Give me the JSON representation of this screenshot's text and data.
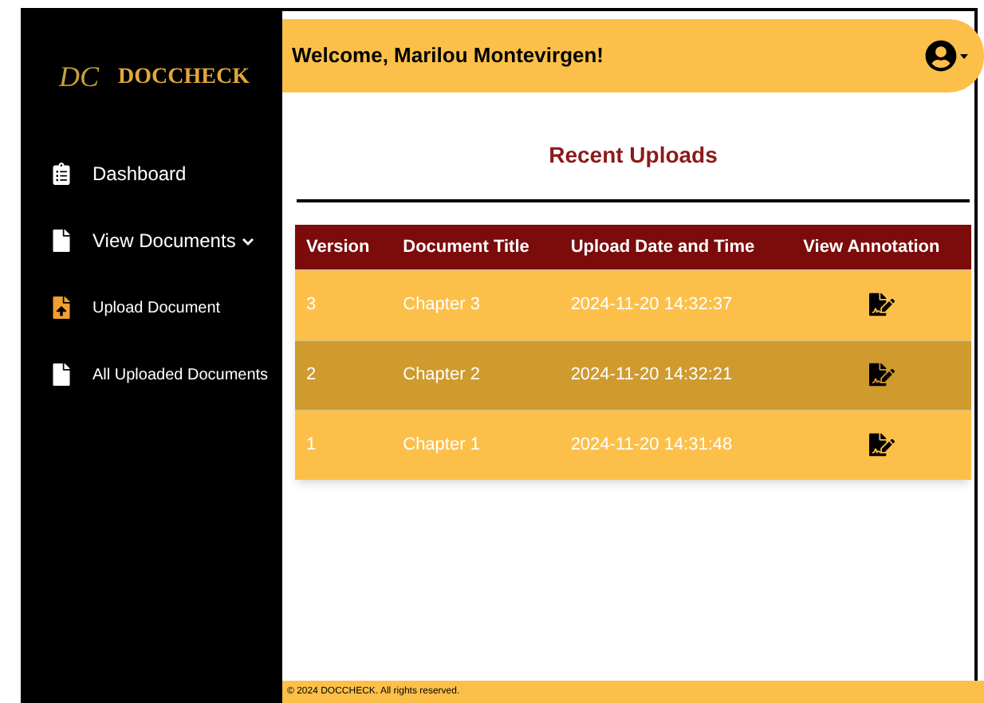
{
  "brand": {
    "logo": "DC",
    "name": "DOCCHECK"
  },
  "sidebar": {
    "items": [
      {
        "label": "Dashboard"
      },
      {
        "label": "View Documents",
        "expanded": true,
        "children": [
          {
            "label": "Upload Document"
          },
          {
            "label": "All Uploaded Documents"
          }
        ]
      }
    ]
  },
  "header": {
    "welcome": "Welcome, Marilou Montevirgen!"
  },
  "section_title": "Recent Uploads",
  "table": {
    "columns": [
      "Version",
      "Document Title",
      "Upload Date and Time",
      "View Annotation"
    ],
    "rows": [
      {
        "version": "3",
        "title": "Chapter 3",
        "datetime": "2024-11-20 14:32:37",
        "selected": false
      },
      {
        "version": "2",
        "title": "Chapter 2",
        "datetime": "2024-11-20 14:32:21",
        "selected": true
      },
      {
        "version": "1",
        "title": "Chapter 1",
        "datetime": "2024-11-20 14:31:48",
        "selected": false
      }
    ]
  },
  "footer": "© 2024 DOCCHECK. All rights reserved."
}
